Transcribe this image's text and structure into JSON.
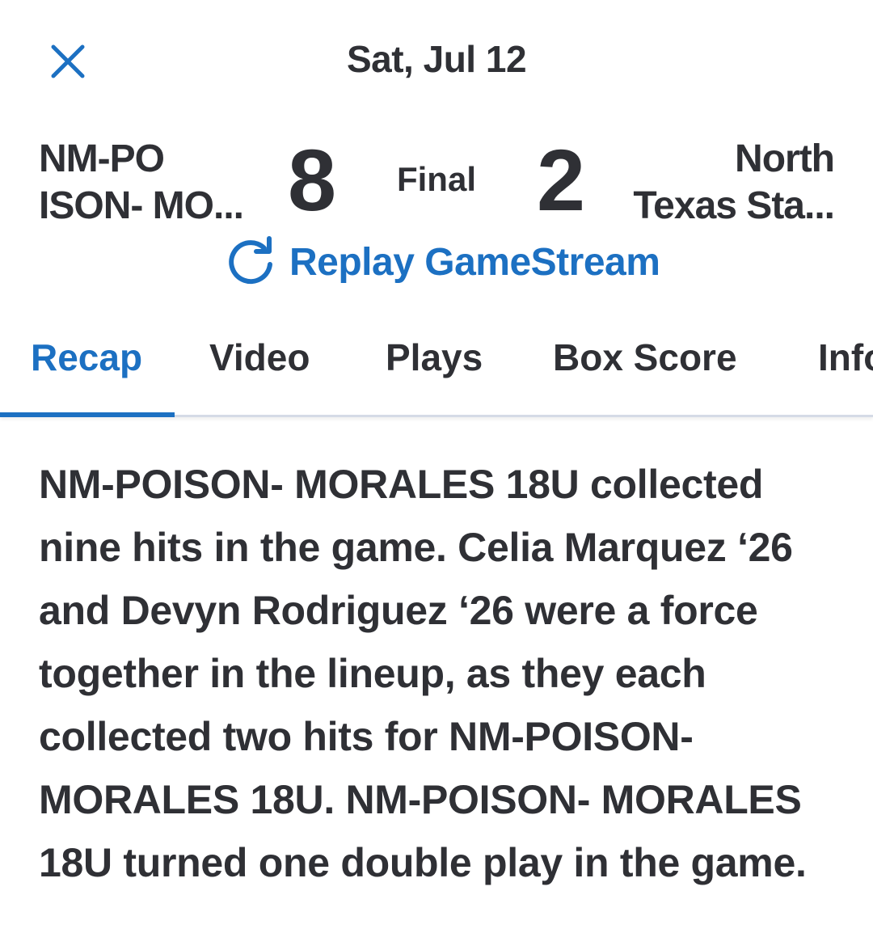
{
  "header": {
    "date": "Sat, Jul 12",
    "close_icon": "close-icon"
  },
  "scoreboard": {
    "home_team": {
      "name_line1": "NM-PO",
      "name_line2": "ISON- MO..."
    },
    "away_team": {
      "name_line1": "North",
      "name_line2": "Texas Sta..."
    },
    "home_score": "8",
    "away_score": "2",
    "status": "Final"
  },
  "replay": {
    "label": "Replay GameStream",
    "icon": "replay-icon"
  },
  "tabs": [
    {
      "label": "Recap",
      "active": true
    },
    {
      "label": "Video",
      "active": false
    },
    {
      "label": "Plays",
      "active": false
    },
    {
      "label": "Box Score",
      "active": false
    },
    {
      "label": "Info",
      "active": false
    }
  ],
  "recap": {
    "text": "NM-POISON- MORALES 18U collected nine hits in the game. Celia Marquez ‘26 and Devyn Rodriguez ‘26 were a force together in the lineup, as they each collected two hits for NM-POISON- MORALES 18U. NM-POISON- MORALES 18U turned one double play in the game."
  },
  "colors": {
    "accent": "#1c70c2",
    "text": "#2f3035",
    "divider": "#d5dbe6"
  }
}
